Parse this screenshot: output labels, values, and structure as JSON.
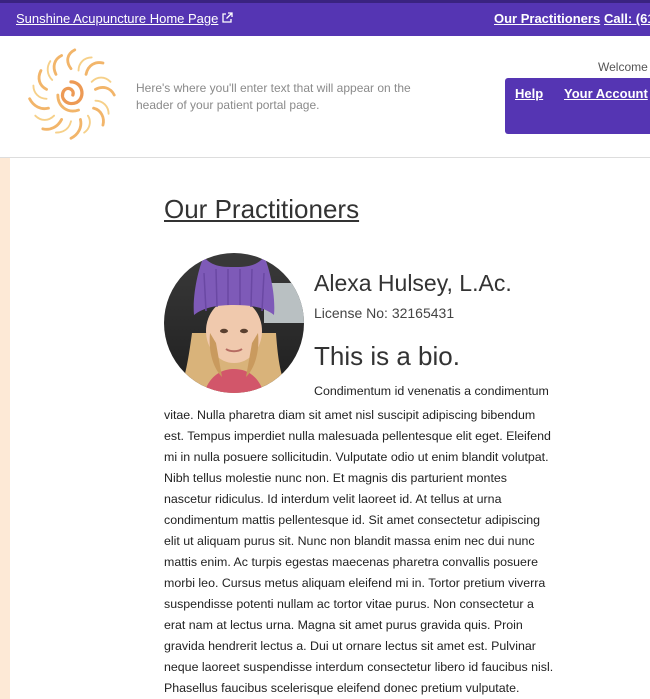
{
  "topbar": {
    "home_link": "Sunshine Acupuncture Home Page",
    "practitioners_link": "Our Practitioners",
    "call_link": "Call: (61",
    "bg_color": "#5535b3"
  },
  "header": {
    "text": "Here's where you'll enter text that will appear on the header of your patient portal page.",
    "welcome": "Welcome",
    "help_link": "Help",
    "account_link": "Your Account"
  },
  "main": {
    "title": "Our Practitioners",
    "practitioner": {
      "name": "Alexa Hulsey, L.Ac.",
      "license": "License No: 32165431",
      "bio_heading": "This is a bio.",
      "bio_first_line": "Condimentum id venenatis a condimentum",
      "bio_lines": [
        "vitae. Nulla pharetra diam sit amet nisl suscipit adipiscing bibendum",
        "est. Tempus imperdiet nulla malesuada pellentesque elit eget. Eleifend",
        "mi in nulla posuere sollicitudin. Vulputate odio ut enim blandit volutpat.",
        "Nibh tellus molestie nunc non. Et magnis dis parturient montes",
        "nascetur ridiculus. Id interdum velit laoreet id. At tellus at urna",
        "condimentum mattis pellentesque id. Sit amet consectetur adipiscing",
        "elit ut aliquam purus sit. Nunc non blandit massa enim nec dui nunc",
        "mattis enim. Ac turpis egestas maecenas pharetra convallis posuere",
        "morbi leo. Cursus metus aliquam eleifend mi in. Tortor pretium viverra",
        "suspendisse potenti nullam ac tortor vitae purus. Non consectetur a",
        "erat nam at lectus urna. Magna sit amet purus gravida quis. Proin",
        "gravida hendrerit lectus a. Dui ut ornare lectus sit amet est. Pulvinar",
        "neque laoreet suspendisse interdum consectetur libero id faucibus nisl.",
        "Phasellus faucibus scelerisque eleifend donec pretium vulputate."
      ]
    }
  },
  "icons": {
    "external_link": "external-link-icon",
    "logo": "sun-logo-icon"
  },
  "colors": {
    "accent": "#5535b3",
    "side_band": "#fde9d6"
  }
}
